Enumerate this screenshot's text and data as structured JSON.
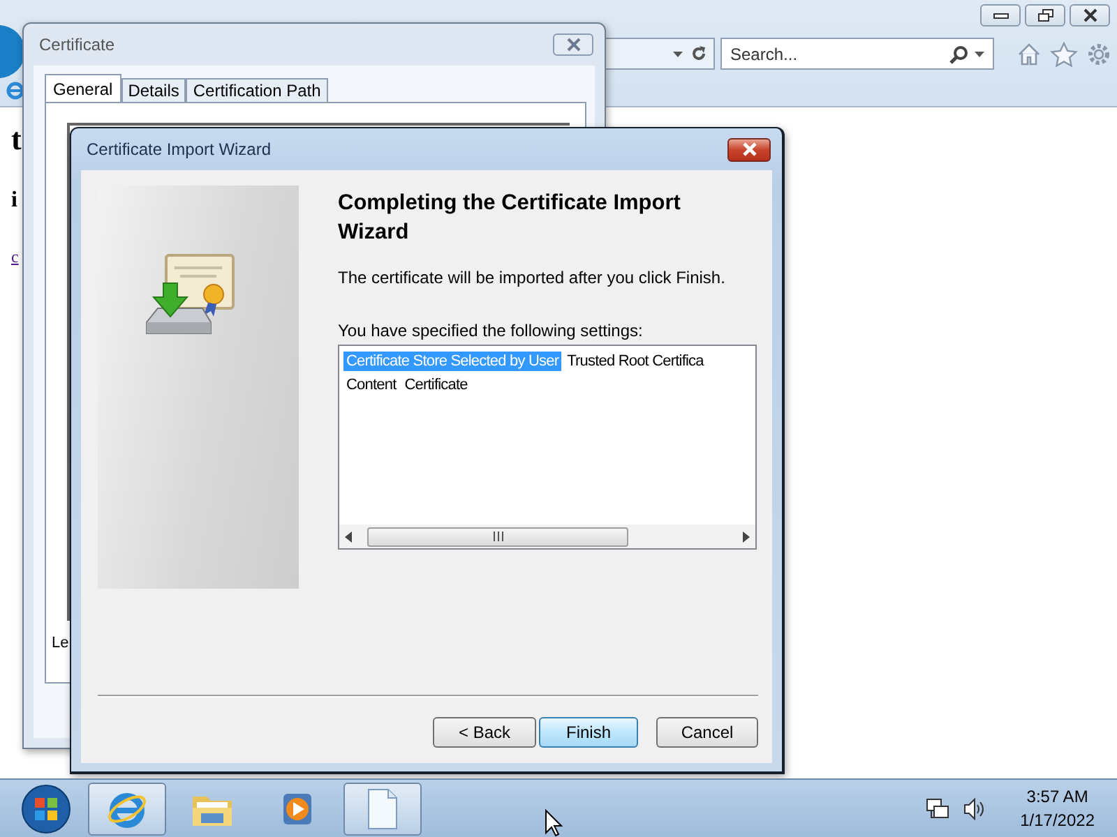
{
  "browser": {
    "search": {
      "placeholder": "Search..."
    },
    "page_text": [
      {
        "kind": "heading",
        "text": "t"
      },
      {
        "kind": "bold",
        "text": "i"
      },
      {
        "kind": "link",
        "text": "c"
      }
    ]
  },
  "certificate_dialog": {
    "title": "Certificate",
    "tabs": [
      {
        "label": "General",
        "selected": true
      },
      {
        "label": "Details",
        "selected": false
      },
      {
        "label": "Certification Path",
        "selected": false
      }
    ],
    "panel_text": "Le"
  },
  "wizard": {
    "title": "Certificate Import Wizard",
    "heading": "Completing the Certificate Import Wizard",
    "description": "The certificate will be imported after you click Finish.",
    "settings_label": "You have specified the following settings:",
    "settings": [
      {
        "name": "Certificate Store Selected by User",
        "value": "Trusted Root Certifica",
        "selected": true
      },
      {
        "name": "Content",
        "value": "Certificate",
        "selected": false
      }
    ],
    "buttons": [
      {
        "label": "< Back",
        "default": false
      },
      {
        "label": "Finish",
        "default": true
      },
      {
        "label": "Cancel",
        "default": false
      }
    ]
  },
  "taskbar": {
    "apps": [
      {
        "kind": "browser",
        "active": true
      },
      {
        "kind": "folder",
        "active": false
      },
      {
        "kind": "media",
        "active": false
      },
      {
        "kind": "document",
        "active": true
      }
    ],
    "clock": {
      "time": "3:57 AM",
      "date": "1/17/2022"
    }
  }
}
